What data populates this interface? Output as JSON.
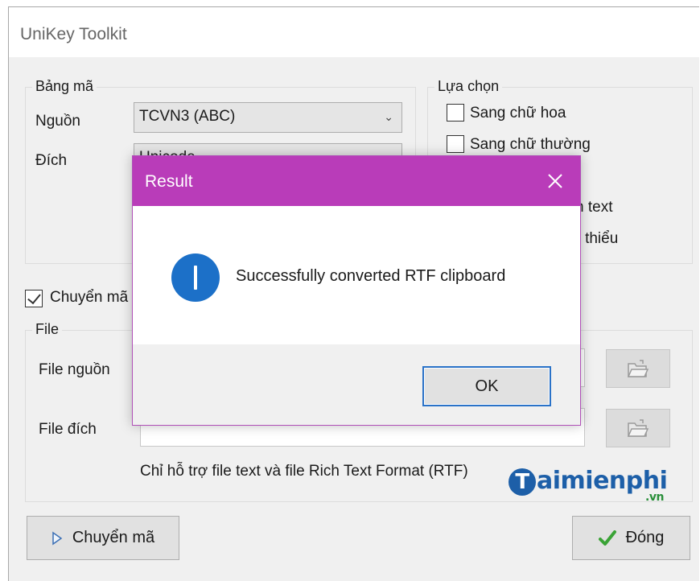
{
  "window": {
    "title": "UniKey Toolkit"
  },
  "bang_ma": {
    "legend": "Bảng mã",
    "source_label": "Nguồn",
    "source_value": "TCVN3 (ABC)",
    "dest_label": "Đích",
    "dest_value": "Unicode"
  },
  "lua_chon": {
    "legend": "Lựa chọn",
    "options": [
      {
        "label": "Sang chữ hoa",
        "checked": false
      },
      {
        "label": "Sang chữ thường",
        "checked": false
      },
      {
        "label": "h text",
        "checked": false
      },
      {
        "label": "bi thiểu",
        "checked": false
      }
    ]
  },
  "clipboard": {
    "label": "Chuyển mã",
    "checked": true
  },
  "file": {
    "legend": "File",
    "source_label": "File nguồn",
    "dest_label": "File đích",
    "note": "Chỉ hỗ trợ file text và file Rich Text Format (RTF)"
  },
  "buttons": {
    "convert": "Chuyển mã",
    "close": "Đóng"
  },
  "watermark": {
    "main": "aimienphi",
    "letter": "T",
    "suffix": ".vn"
  },
  "dialog": {
    "title": "Result",
    "message": "Successfully converted RTF clipboard",
    "ok": "OK"
  },
  "colors": {
    "dialog_titlebar": "#b93cb9",
    "info_icon": "#1c70c8",
    "ok_border": "#2a72c8"
  }
}
